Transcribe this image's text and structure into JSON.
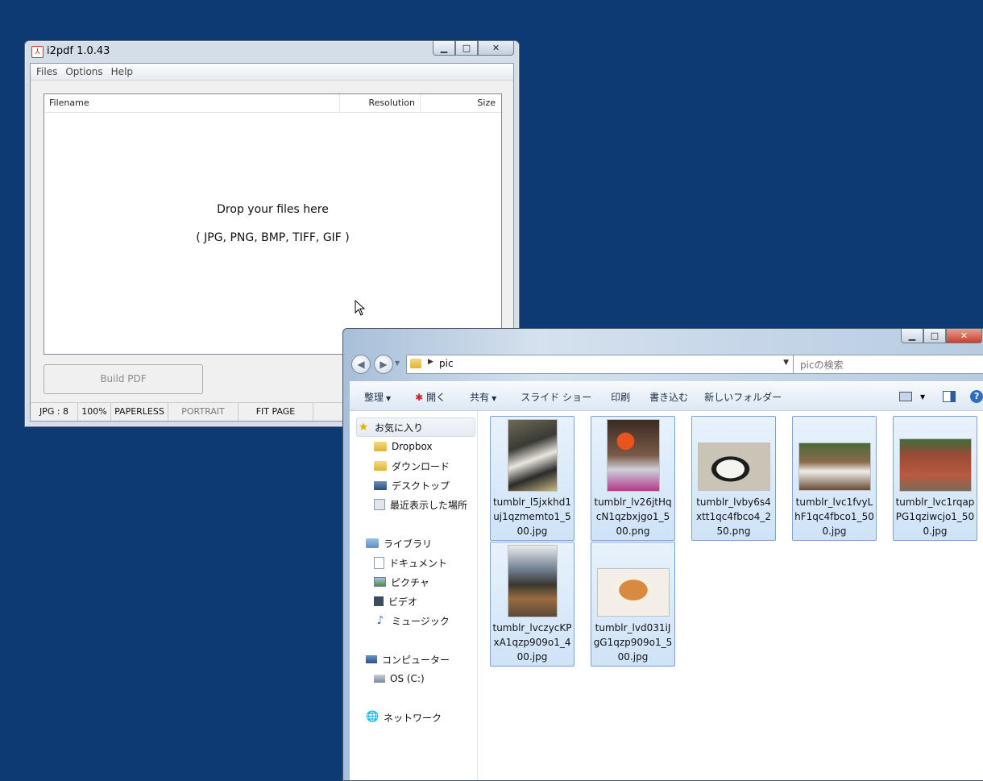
{
  "i2pdf": {
    "title": "i2pdf 1.0.43",
    "menu": [
      "Files",
      "Options",
      "Help"
    ],
    "columns": {
      "filename": "Filename",
      "resolution": "Resolution",
      "size": "Size"
    },
    "drop_line1": "Drop your files here",
    "drop_line2": "( JPG, PNG, BMP, TIFF, GIF )",
    "build_button": "Build PDF",
    "status": [
      "JPG : 8",
      "100%",
      "PAPERLESS",
      "PORTRAIT",
      "FIT PAGE"
    ]
  },
  "explorer": {
    "address": "pic",
    "search_placeholder": "picの検索",
    "toolbar": [
      "整理",
      "開く",
      "共有",
      "スライド ショー",
      "印刷",
      "書き込む",
      "新しいフォルダー"
    ],
    "nav": {
      "favorites": "お気に入り",
      "favorites_items": [
        "Dropbox",
        "ダウンロード",
        "デスクトップ",
        "最近表示した場所"
      ],
      "libraries": "ライブラリ",
      "libraries_items": [
        "ドキュメント",
        "ピクチャ",
        "ビデオ",
        "ミュージック"
      ],
      "computer": "コンピューター",
      "computer_items": [
        "OS (C:)"
      ],
      "network": "ネットワーク"
    },
    "files": [
      "tumblr_l5jxkhd1uj1qzmemto1_500.jpg",
      "tumblr_lv26jtHqcN1qzbxjgo1_500.png",
      "tumblr_lvby6s4xtt1qc4fbco4_250.png",
      "tumblr_lvc1fvyLhF1qc4fbco1_500.jpg",
      "tumblr_lvc1rqapPG1qziwcjo1_500.jpg",
      "tumblr_lvczycKPxA1qzp909o1_400.jpg",
      "tumblr_lvd031iJgG1qzp909o1_500.jpg"
    ]
  }
}
